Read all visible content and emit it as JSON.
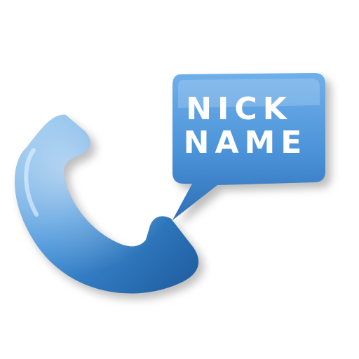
{
  "app_icon": {
    "name": "nickname-caller-app-icon",
    "bubble": {
      "line1": "NICK",
      "line2": "NAME"
    },
    "colors": {
      "phone_light": "#8ec3f0",
      "phone_mid": "#3f8fd8",
      "phone_dark": "#1d5a9c",
      "bubble_light": "#6fb0ea",
      "bubble_dark": "#2f6fb5",
      "text": "#ffffff",
      "shadow": "#9a9a9a",
      "background": "#ffffff"
    }
  }
}
